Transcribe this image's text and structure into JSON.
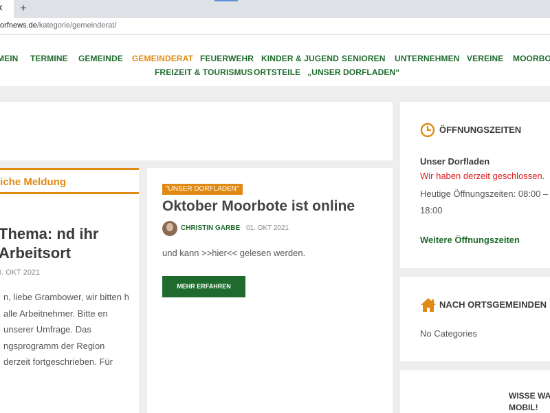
{
  "browser": {
    "tab_close": "✕",
    "new_tab": "+",
    "url_host": "orfnews.de",
    "url_path": "/kategorie/gemeinderat/"
  },
  "nav": {
    "row1": [
      "MEIN",
      "TERMINE",
      "GEMEINDE",
      "GEMEINDERAT",
      "FEUERWEHR",
      "KINDER & JUGEND",
      "SENIOREN",
      "UNTERNEHMEN",
      "VEREINE",
      "MOORBOTE"
    ],
    "row2": [
      "FREIZEIT & TOURISMUS",
      "ORTSTEILE",
      "„UNSER DORFLADEN“"
    ],
    "active": "GEMEINDERAT"
  },
  "page": {
    "title": "t"
  },
  "left_post": {
    "tab_label": "liche Meldung",
    "title": "Thema: nd ihr Arbeitsort",
    "date": "0. OKT 2021",
    "excerpt": "n, liebe Grambower, wir bitten h alle Arbeitnehmer. Bitte en unserer Umfrage. Das ngsprogramm der Region derzeit fortgeschrieben. Für"
  },
  "main_post": {
    "category": "\"UNSER DORFLADEN\"",
    "title": "Oktober Moorbote ist online",
    "author": "CHRISTIN GARBE",
    "separator": "·",
    "date": "01. OKT 2021",
    "excerpt": "und kann >>hier<< gelesen werden.",
    "button": "MEHR ERFAHREN"
  },
  "sidebar": {
    "opening": {
      "title": "ÖFFNUNGSZEITEN",
      "icon": "clock-icon",
      "shop": "Unser Dorfladen",
      "status": "Wir haben derzeit geschlossen.",
      "today": "Heutige Öffnungszeiten: 08:00 – 18:00",
      "link": "Weitere Öffnungszeiten"
    },
    "towns": {
      "title": "NACH ORTSGEMEINDEN",
      "icon": "home-icon",
      "empty": "No Categories"
    },
    "promo": {
      "text": "WISSE WA MOBIL!"
    }
  },
  "colors": {
    "brand_green": "#1f6b2e",
    "accent_orange": "#e08a14",
    "closed_red": "#e02020"
  }
}
